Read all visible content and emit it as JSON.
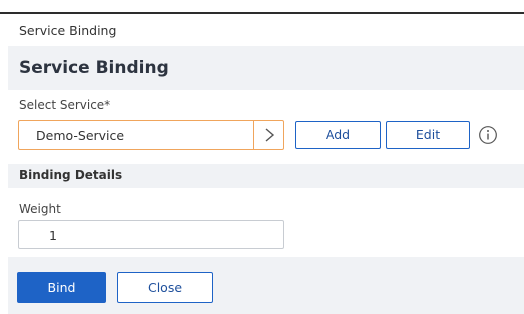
{
  "breadcrumb": "Service Binding",
  "page_title": "Service Binding",
  "select_service": {
    "label": "Select Service*",
    "value": "Demo-Service",
    "add_label": "Add",
    "edit_label": "Edit"
  },
  "binding_details": {
    "title": "Binding Details",
    "weight_label": "Weight",
    "weight_value": "1"
  },
  "footer": {
    "bind_label": "Bind",
    "close_label": "Close"
  },
  "icons": {
    "chevron": "chevron-right-icon",
    "info": "info-icon"
  },
  "colors": {
    "accent": "#1e63c6",
    "focus_border": "#f0a55c",
    "panel_bg": "#f0f2f5"
  }
}
